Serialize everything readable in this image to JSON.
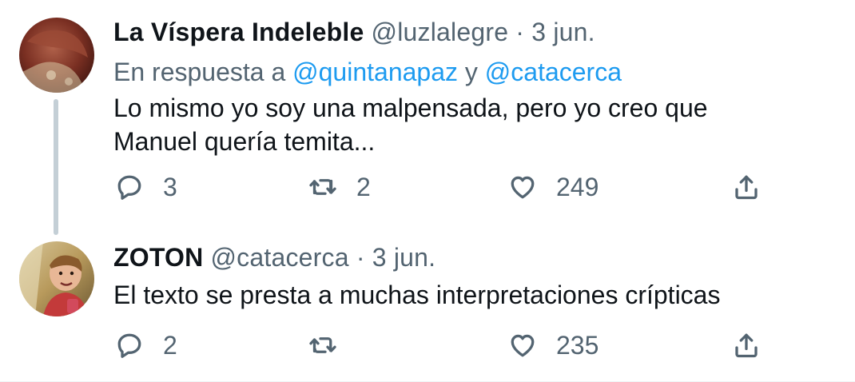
{
  "tweets": [
    {
      "name": "La Víspera Indeleble",
      "handle": "@luzlalegre",
      "separator": "·",
      "date": "3 jun.",
      "reply_to": {
        "prefix": "En respuesta a",
        "mention1": "@quintanapaz",
        "conjunction": "y",
        "mention2": "@catacerca"
      },
      "text_lines": [
        "Lo mismo yo soy una malpensada, pero yo creo que",
        "Manuel quería temita..."
      ],
      "actions": {
        "reply_icon": "comment-icon",
        "reply_count": "3",
        "retweet_icon": "retweet-icon",
        "retweet_count": "2",
        "like_icon": "heart-icon",
        "like_count": "249",
        "share_icon": "share-icon"
      }
    },
    {
      "name": "ZOTON",
      "handle": "@catacerca",
      "separator": "·",
      "date": "3 jun.",
      "text_lines": [
        "El texto se presta a muchas interpretaciones crípticas"
      ],
      "actions": {
        "reply_icon": "comment-icon",
        "reply_count": "2",
        "retweet_icon": "retweet-icon",
        "retweet_count": "",
        "like_icon": "heart-icon",
        "like_count": "235",
        "share_icon": "share-icon"
      }
    }
  ],
  "colors": {
    "text": "#0f1419",
    "secondary": "#536471",
    "link": "#1d9bf0",
    "thread_line": "#c4cfd6"
  }
}
